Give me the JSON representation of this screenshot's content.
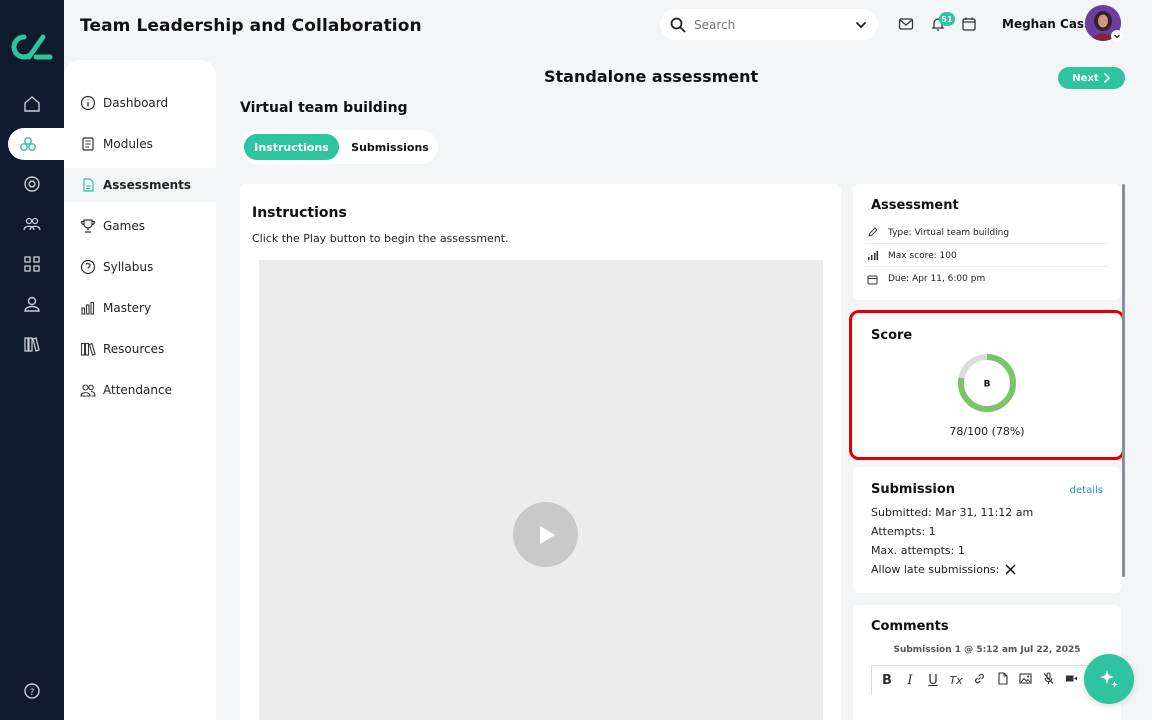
{
  "header": {
    "course_title": "Team Leadership and Collaboration",
    "search_placeholder": "Search",
    "notification_count": "51",
    "user_name": "Meghan Cass"
  },
  "sidebar": {
    "items": [
      {
        "label": "Dashboard",
        "icon": "info-icon"
      },
      {
        "label": "Modules",
        "icon": "book-icon"
      },
      {
        "label": "Assessments",
        "icon": "document-icon",
        "active": true
      },
      {
        "label": "Games",
        "icon": "trophy-icon"
      },
      {
        "label": "Syllabus",
        "icon": "syllabus-icon"
      },
      {
        "label": "Mastery",
        "icon": "bar-chart-icon"
      },
      {
        "label": "Resources",
        "icon": "library-icon"
      },
      {
        "label": "Attendance",
        "icon": "people-icon"
      }
    ]
  },
  "page": {
    "title": "Standalone assessment",
    "next_label": "Next",
    "assessment_name": "Virtual team building",
    "tabs": [
      {
        "label": "Instructions",
        "active": true
      },
      {
        "label": "Submissions",
        "active": false
      }
    ]
  },
  "instructions": {
    "title": "Instructions",
    "text": "Click the Play button to begin the assessment."
  },
  "assessment": {
    "title": "Assessment",
    "type": "Type: Virtual team building",
    "max_score": "Max score: 100",
    "due": "Due: Apr 11, 6:00 pm"
  },
  "score": {
    "title": "Score",
    "grade": "B",
    "text": "78/100 (78%)",
    "fraction": 0.78,
    "color": "#7cc36a",
    "track_color": "#dcdcdc"
  },
  "submission": {
    "title": "Submission",
    "details_label": "details",
    "submitted": "Submitted: Mar 31, 11:12 am",
    "attempts": "Attempts: 1",
    "max_attempts": "Max. attempts: 1",
    "late": "Allow late submissions:"
  },
  "comments": {
    "title": "Comments",
    "submission_line": "Submission 1 @ 5:12 am Jul 22, 2025",
    "toolbar": [
      "B",
      "I",
      "U",
      "Tx"
    ]
  },
  "colors": {
    "accent": "#2ec4a0",
    "rail": "#0f1a2e",
    "highlight_border": "#e00000"
  }
}
